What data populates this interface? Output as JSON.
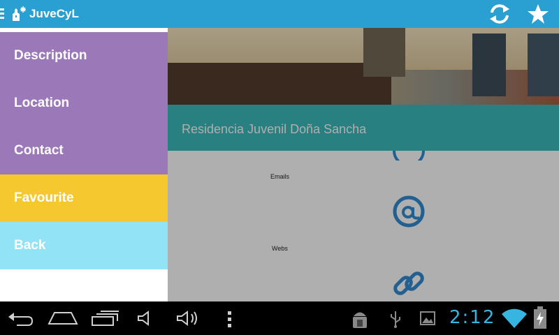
{
  "app": {
    "title": "JuveCyL"
  },
  "residence": {
    "name": "Residencia Juvenil Doña Sancha"
  },
  "sections": {
    "emails_label": "Emails",
    "webs_label": "Webs"
  },
  "drawer": {
    "items": [
      {
        "label": "Description",
        "color": "#9b78b8"
      },
      {
        "label": "Location",
        "color": "#9b78b8"
      },
      {
        "label": "Contact",
        "color": "#9b78b8"
      },
      {
        "label": "Favourite",
        "color": "#f6c82f"
      },
      {
        "label": "Back",
        "color": "#92e3f6"
      }
    ]
  },
  "system_bar": {
    "time": "2:12"
  },
  "colors": {
    "action_bar": "#2a9fd1",
    "accent": "#2f86c8",
    "title_band": "#38b2b2"
  }
}
